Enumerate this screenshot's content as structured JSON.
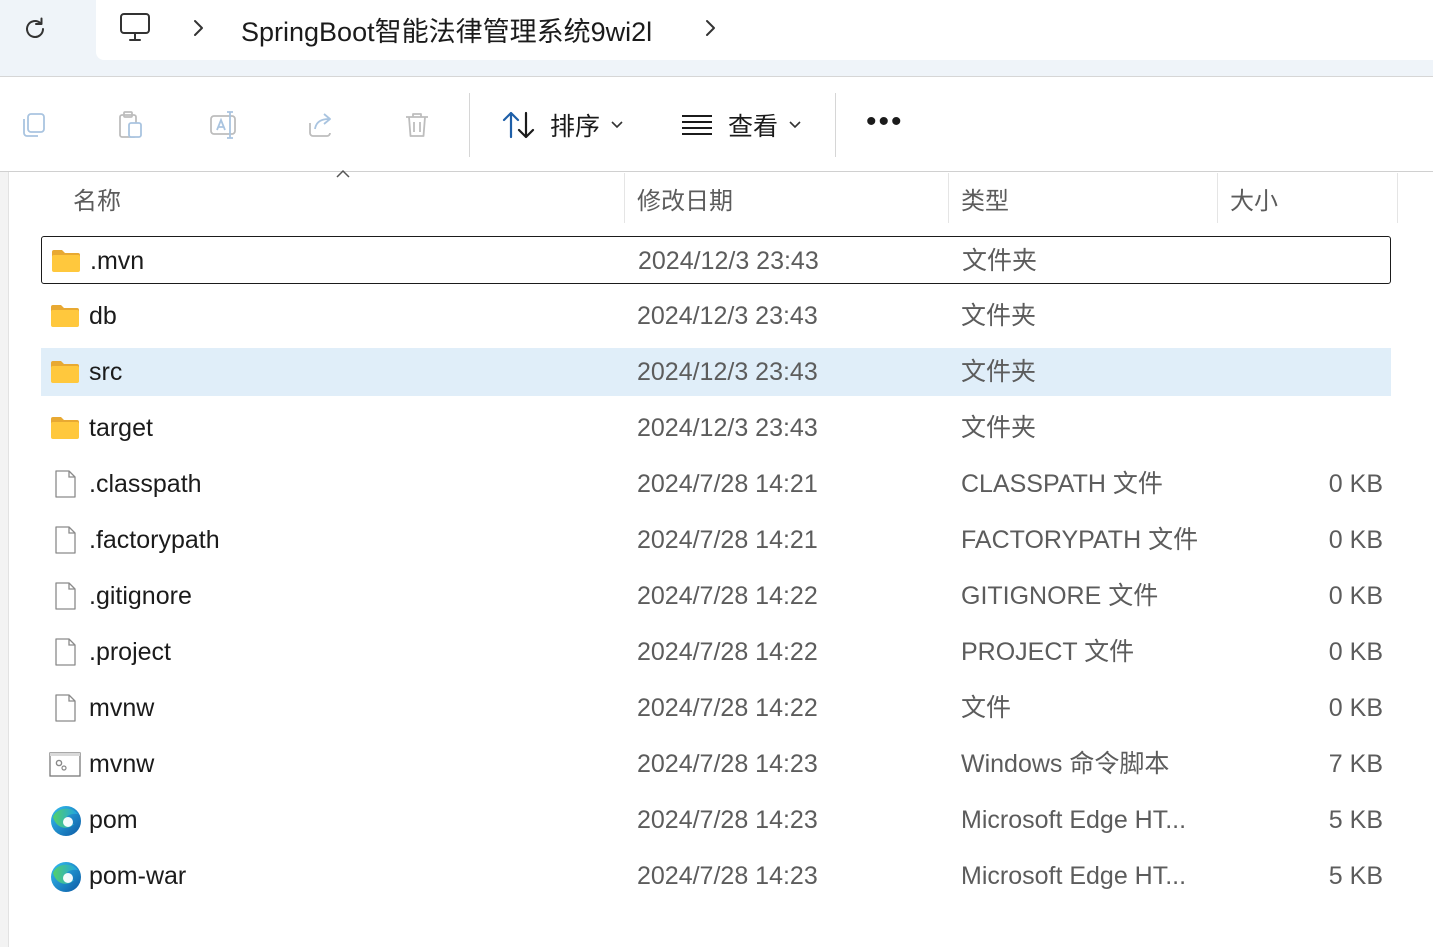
{
  "address": {
    "breadcrumb": "SpringBoot智能法律管理系统9wi2l"
  },
  "toolbar": {
    "sort_label": "排序",
    "view_label": "查看",
    "more_label": "•••"
  },
  "columns": {
    "name": "名称",
    "date": "修改日期",
    "type": "类型",
    "size": "大小"
  },
  "files": [
    {
      "name": ".mvn",
      "date": "2024/12/3 23:43",
      "type": "文件夹",
      "size": "",
      "icon": "folder-icon"
    },
    {
      "name": "db",
      "date": "2024/12/3 23:43",
      "type": "文件夹",
      "size": "",
      "icon": "folder-icon"
    },
    {
      "name": "src",
      "date": "2024/12/3 23:43",
      "type": "文件夹",
      "size": "",
      "icon": "folder-icon"
    },
    {
      "name": "target",
      "date": "2024/12/3 23:43",
      "type": "文件夹",
      "size": "",
      "icon": "folder-icon"
    },
    {
      "name": ".classpath",
      "date": "2024/7/28 14:21",
      "type": "CLASSPATH 文件",
      "size": "0 KB",
      "icon": "file-icon"
    },
    {
      "name": ".factorypath",
      "date": "2024/7/28 14:21",
      "type": "FACTORYPATH 文件",
      "size": "0 KB",
      "icon": "file-icon"
    },
    {
      "name": ".gitignore",
      "date": "2024/7/28 14:22",
      "type": "GITIGNORE 文件",
      "size": "0 KB",
      "icon": "file-icon"
    },
    {
      "name": ".project",
      "date": "2024/7/28 14:22",
      "type": "PROJECT 文件",
      "size": "0 KB",
      "icon": "file-icon"
    },
    {
      "name": "mvnw",
      "date": "2024/7/28 14:22",
      "type": "文件",
      "size": "0 KB",
      "icon": "file-icon"
    },
    {
      "name": "mvnw",
      "date": "2024/7/28 14:23",
      "type": "Windows 命令脚本",
      "size": "7 KB",
      "icon": "script-icon"
    },
    {
      "name": "pom",
      "date": "2024/7/28 14:23",
      "type": "Microsoft Edge HT...",
      "size": "5 KB",
      "icon": "edge-icon"
    },
    {
      "name": "pom-war",
      "date": "2024/7/28 14:23",
      "type": "Microsoft Edge HT...",
      "size": "5 KB",
      "icon": "edge-icon"
    }
  ]
}
